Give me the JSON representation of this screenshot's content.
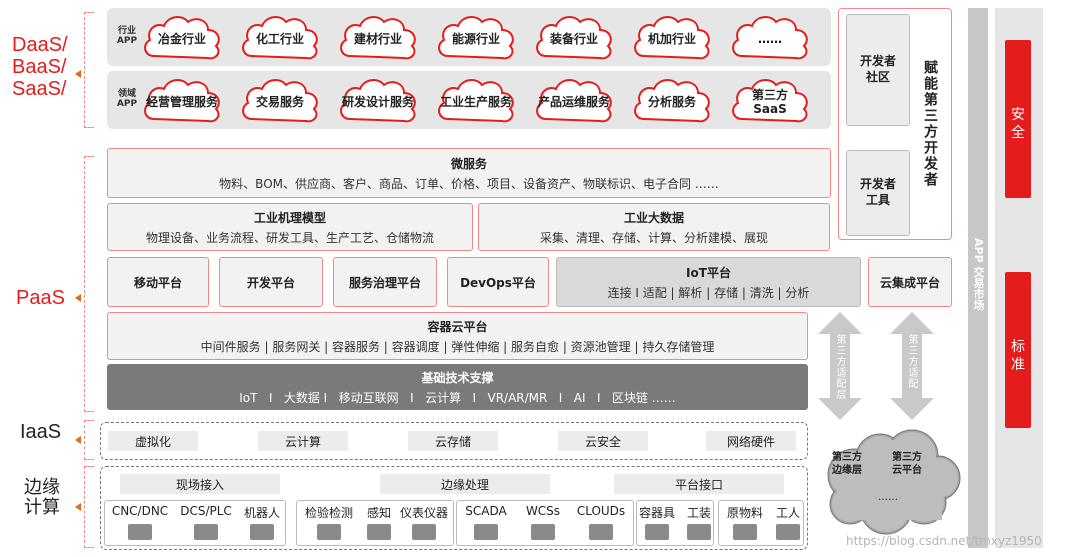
{
  "layers": {
    "daas": "DaaS/\nBaaS/\nSaaS/",
    "paas": "PaaS",
    "iaas": "IaaS",
    "edge": "边缘\n计算"
  },
  "saas": {
    "industry_tag": "行业\nAPP",
    "domain_tag": "领域\nAPP",
    "industry_apps": [
      "冶金行业",
      "化工行业",
      "建材行业",
      "能源行业",
      "装备行业",
      "机加行业",
      "……"
    ],
    "domain_apps": [
      "经营管理服务",
      "交易服务",
      "研发设计服务",
      "工业生产服务",
      "产品运维服务",
      "分析服务",
      "第三方\nSaaS"
    ]
  },
  "paas": {
    "microservice": {
      "title": "微服务",
      "items": "物料、BOM、供应商、客户、商品、订单、价格、项目、设备资产、物联标识、电子合同 ……"
    },
    "mechanism": {
      "title": "工业机理模型",
      "items": "物理设备、业务流程、研发工具、生产工艺、仓储物流"
    },
    "bigdata": {
      "title": "工业大数据",
      "items": "采集、清理、存储、计算、分析建模、展现"
    },
    "platforms": [
      "移动平台",
      "开发平台",
      "服务治理平台",
      "DevOps平台"
    ],
    "iot": {
      "title": "IoT平台",
      "items": "连接 I 适配 | 解析 | 存储 | 清洗 | 分析"
    },
    "cloud_integration": "云集成平台",
    "container": {
      "title": "容器云平台",
      "items": "中间件服务 | 服务网关 | 容器服务 | 容器调度 | 弹性伸缩 | 服务自愈 | 资源池管理 | 持久存储管理"
    },
    "infra": {
      "title": "基础技术支撑",
      "items": "IoT   I   大数据 I   移动互联网   I   云计算   I   VR/AR/MR   I   AI   I   区块链 ……"
    }
  },
  "iaas": {
    "items": [
      "虚拟化",
      "云计算",
      "云存储",
      "云安全",
      "网络硬件"
    ]
  },
  "edge": {
    "headers": [
      "现场接入",
      "边缘处理",
      "平台接口"
    ],
    "devices": [
      "CNC/DNC",
      "DCS/PLC",
      "机器人",
      "检验检测",
      "感知",
      "仪表仪器",
      "SCADA",
      "WCSs",
      "CLOUDs",
      "容器具",
      "工装",
      "原物料",
      "工人"
    ]
  },
  "developer": {
    "community": "开发者\n社区",
    "tools": "开发者\n工具",
    "empower": "赋能第三方开发者"
  },
  "adapter": {
    "left": "第三方适配层",
    "right": "第三方适配"
  },
  "third_party_clouds": {
    "edge_layer": "第三方\n边缘层",
    "cloud_platform": "第三方\n云平台",
    "more": "……"
  },
  "app_market": "APP 交易市场",
  "right_column": {
    "security": "安全",
    "standard": "标准"
  },
  "watermark": "https://blog.csdn.net/tmxyz1950",
  "colors": {
    "accent": "#e51c1c",
    "border": "#f08a8a",
    "dark": "#7a7a7a"
  }
}
